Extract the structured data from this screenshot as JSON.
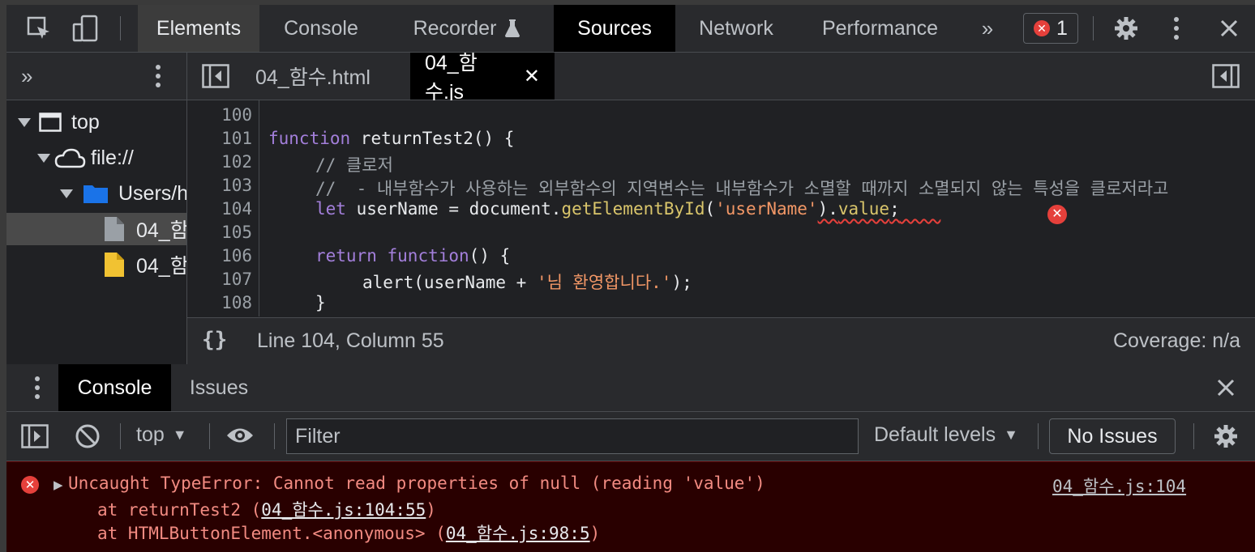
{
  "main_tabs": [
    "Elements",
    "Console",
    "Recorder",
    "Sources",
    "Network",
    "Performance"
  ],
  "error_count": "1",
  "navigator": {
    "items": [
      {
        "label": "top"
      },
      {
        "label": "file://"
      },
      {
        "label": "Users/h"
      },
      {
        "label": "04_함"
      },
      {
        "label": "04_함"
      }
    ]
  },
  "editor": {
    "tabs": [
      {
        "label": "04_함수.html"
      },
      {
        "label": "04_함수.js"
      }
    ],
    "lines": [
      {
        "n": "100"
      },
      {
        "n": "101"
      },
      {
        "n": "102"
      },
      {
        "n": "103"
      },
      {
        "n": "104"
      },
      {
        "n": "105"
      },
      {
        "n": "106"
      },
      {
        "n": "107"
      },
      {
        "n": "108"
      }
    ],
    "code": {
      "l101_kw": "function",
      "l101_rest": " returnTest2() {",
      "l102": "// 클로저",
      "l103": "//  - 내부함수가 사용하는 외부함수의 지역변수는 내부함수가 소멸할 때까지 소멸되지 않는 특성을 클로저라고",
      "l104_kw": "let",
      "l104_a": " userName = document.",
      "l104_m": "getElementById",
      "l104_b": "(",
      "l104_s": "'userName'",
      "l104_c": ").",
      "l104_v": "value",
      "l104_d": ";",
      "l106_kw": "return",
      "l106_kw2": "function",
      "l106_rest": "() {",
      "l107_a": "alert(userName + ",
      "l107_s": "'님 환영합니다.'",
      "l107_b": ");",
      "l108": "}"
    },
    "status_position": "Line 104, Column 55",
    "coverage": "Coverage: n/a",
    "braces": "{}"
  },
  "drawer": {
    "tabs": [
      "Console",
      "Issues"
    ],
    "context": "top",
    "filter_placeholder": "Filter",
    "levels": "Default levels",
    "no_issues": "No Issues"
  },
  "console_error": {
    "message": "Uncaught TypeError: Cannot read properties of null (reading 'value')",
    "source": "04_함수.js:104",
    "stack1_pre": "at returnTest2 (",
    "stack1_link": "04_함수.js:104:55",
    "stack1_post": ")",
    "stack2_pre": "at HTMLButtonElement.<anonymous> (",
    "stack2_link": "04_함수.js:98:5",
    "stack2_post": ")"
  },
  "colors": {
    "error": "#e5403b",
    "keyword": "#9a7fd5",
    "string": "#f29766",
    "method": "#d9c56b"
  }
}
